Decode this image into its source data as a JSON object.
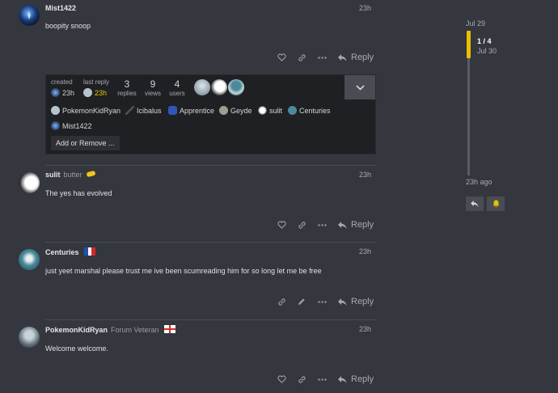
{
  "posts": [
    {
      "username": "Mist1422",
      "user_title": "",
      "time": "23h",
      "body": "boopity snoop",
      "reply_label": "Reply"
    },
    {
      "username": "sulit",
      "user_title": "butter",
      "time": "23h",
      "body": "The yes has evolved",
      "reply_label": "Reply"
    },
    {
      "username": "Centuries",
      "user_title": "",
      "time": "23h",
      "body": "just yeet marshal please trust me ive been scumreading him for so long let me be free",
      "reply_label": "Reply"
    },
    {
      "username": "PokemonKidRyan",
      "user_title": "Forum Veteran",
      "time": "23h",
      "body": "Welcome welcome.",
      "reply_label": "Reply"
    }
  ],
  "summary": {
    "created_label": "created",
    "created_time": "23h",
    "last_reply_label": "last reply",
    "last_reply_time": "23h",
    "replies_count": "3",
    "replies_label": "replies",
    "views_count": "9",
    "views_label": "views",
    "users_count": "4",
    "users_label": "users",
    "participants": [
      "PokemonKidRyan",
      "Icibalus",
      "Apprentice",
      "Geyde",
      "sulit",
      "Centuries",
      "Mist1422"
    ],
    "add_remove_label": "Add or Remove ..."
  },
  "timeline": {
    "start_date": "Jul 29",
    "position": "1 / 4",
    "position_date": "Jul 30",
    "end_label": "23h ago"
  },
  "colors": {
    "background": "#35373f",
    "accent": "#e8c000",
    "summary_bg": "#1f2024"
  }
}
